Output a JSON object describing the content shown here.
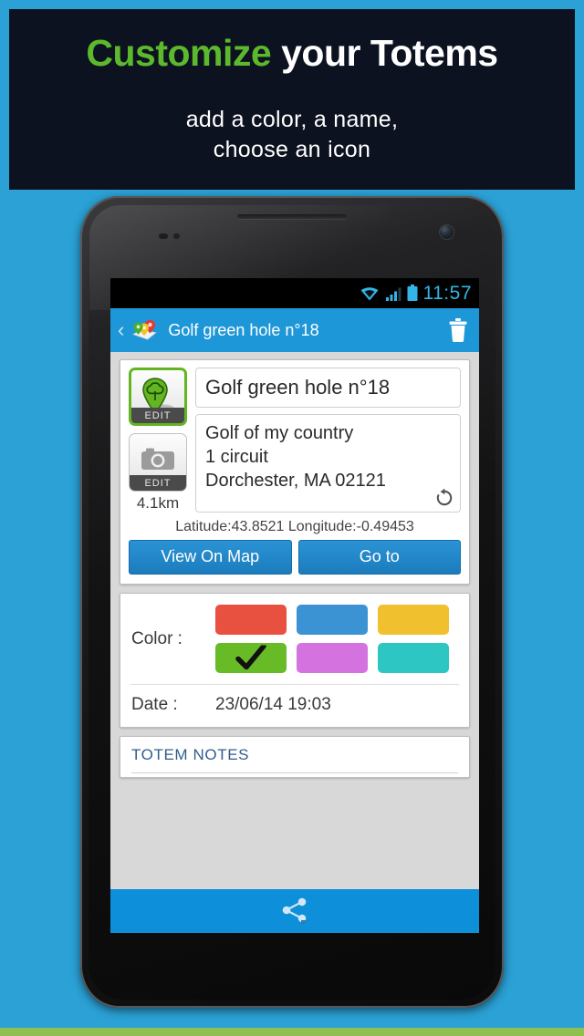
{
  "promo": {
    "title_highlight": "Customize",
    "title_rest": " your Totems",
    "subtitle_line1": "add  a color, a name,",
    "subtitle_line2": "choose an icon",
    "highlight_color": "#5cb82c",
    "background_color": "#0d1220"
  },
  "page_background": "#2ba1d6",
  "bottom_strip_color": "#8cc152",
  "status_bar": {
    "wifi_icon": "wifi-icon",
    "signal_icon": "cellular-signal-icon",
    "battery_icon": "battery-icon",
    "time": "11:57",
    "accent_color": "#33b5e5"
  },
  "action_bar": {
    "back_icon": "back-chevron-icon",
    "app_logo_icon": "map-pins-logo-icon",
    "title": "Golf green hole n°18",
    "delete_icon": "trash-icon",
    "background_color": "#1e97d8"
  },
  "detail_card": {
    "icon_thumb": {
      "art_icon": "tree-map-pin-icon",
      "edit_label": "EDIT",
      "selected": true,
      "border_color": "#63b521"
    },
    "photo_thumb": {
      "art_icon": "camera-icon",
      "edit_label": "EDIT"
    },
    "distance": "4.1km",
    "name_field": "Golf green hole n°18",
    "address_line1": "Golf of my country",
    "address_line2": "1 circuit",
    "address_line3": "Dorchester, MA 02121",
    "refresh_icon": "refresh-ccw-icon",
    "coordinates": "Latitude:43.8521 Longitude:-0.49453",
    "buttons": [
      {
        "label": "View On Map",
        "name": "view-on-map-button"
      },
      {
        "label": "Go to",
        "name": "go-to-button"
      }
    ]
  },
  "color_card": {
    "color_label": "Color :",
    "swatches": [
      {
        "name": "swatch-red",
        "hex": "#e8503f",
        "selected": false
      },
      {
        "name": "swatch-blue",
        "hex": "#3b93d4",
        "selected": false
      },
      {
        "name": "swatch-yellow",
        "hex": "#f0c02e",
        "selected": false
      },
      {
        "name": "swatch-green",
        "hex": "#66bb26",
        "selected": true
      },
      {
        "name": "swatch-pink",
        "hex": "#d472e0",
        "selected": false
      },
      {
        "name": "swatch-teal",
        "hex": "#2ec6c2",
        "selected": false
      }
    ],
    "check_icon": "checkmark-icon",
    "date_label": "Date :",
    "date_value": "23/06/14 19:03"
  },
  "notes_card": {
    "title": "TOTEM NOTES"
  },
  "share_bar": {
    "share_icon": "share-icon",
    "background_color": "#0d8fd9"
  }
}
